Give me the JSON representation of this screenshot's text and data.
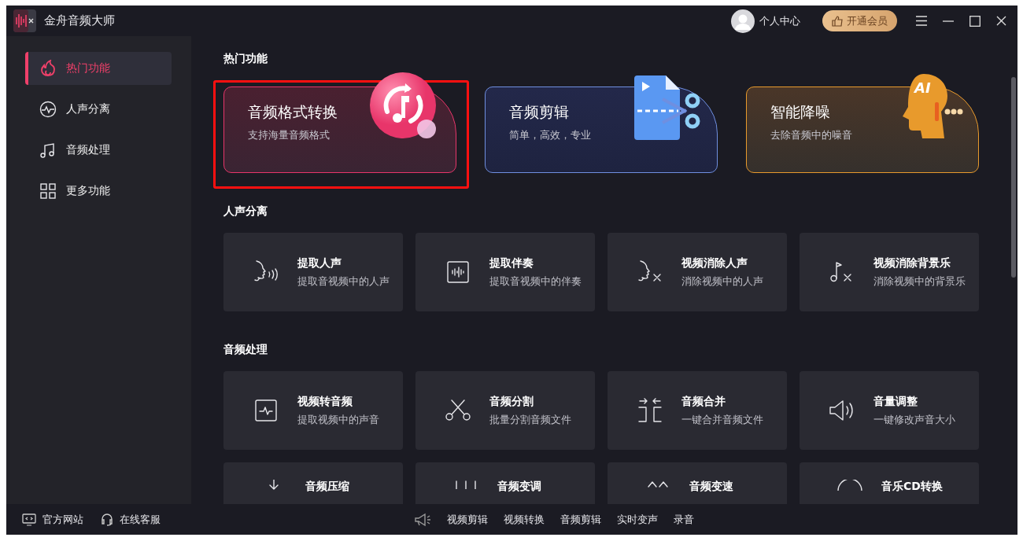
{
  "window": {
    "title": "金舟音频大师"
  },
  "header": {
    "user_label": "个人中心",
    "vip_button": "开通会员"
  },
  "sidebar": {
    "items": [
      {
        "label": "热门功能",
        "selected": true
      },
      {
        "label": "人声分离",
        "selected": false
      },
      {
        "label": "音频处理",
        "selected": false
      },
      {
        "label": "更多功能",
        "selected": false
      }
    ]
  },
  "sections": [
    {
      "title": "热门功能",
      "kind": "featured",
      "cards": [
        {
          "title": "音频格式转换",
          "subtitle": "支持海量音频格式",
          "color": "#e8356a",
          "highlighted": true
        },
        {
          "title": "音频剪辑",
          "subtitle": "简单，高效，专业",
          "color": "#6f8fe0",
          "highlighted": false
        },
        {
          "title": "智能降噪",
          "subtitle": "去除音频中的噪音",
          "color": "#e89a2c",
          "highlighted": false,
          "badge": "AI"
        }
      ]
    },
    {
      "title": "人声分离",
      "kind": "tools",
      "cards": [
        {
          "title": "提取人声",
          "subtitle": "提取音视频中的人声"
        },
        {
          "title": "提取伴奏",
          "subtitle": "提取音视频中的伴奏"
        },
        {
          "title": "视频消除人声",
          "subtitle": "消除视频中的人声"
        },
        {
          "title": "视频消除背景乐",
          "subtitle": "消除视频中的背景乐"
        }
      ]
    },
    {
      "title": "音频处理",
      "kind": "tools",
      "cards": [
        {
          "title": "视频转音频",
          "subtitle": "提取视频中的声音"
        },
        {
          "title": "音频分割",
          "subtitle": "批量分割音频文件"
        },
        {
          "title": "音频合并",
          "subtitle": "一键合并音频文件"
        },
        {
          "title": "音量调整",
          "subtitle": "一键修改声音大小"
        },
        {
          "title": "音频压缩"
        },
        {
          "title": "音频变调"
        },
        {
          "title": "音频变速"
        },
        {
          "title": "音乐CD转换"
        }
      ]
    }
  ],
  "footer": {
    "links": [
      "官方网站",
      "在线客服"
    ],
    "quick_links": [
      "视频剪辑",
      "视频转换",
      "音频剪辑",
      "实时变声",
      "录音"
    ]
  }
}
